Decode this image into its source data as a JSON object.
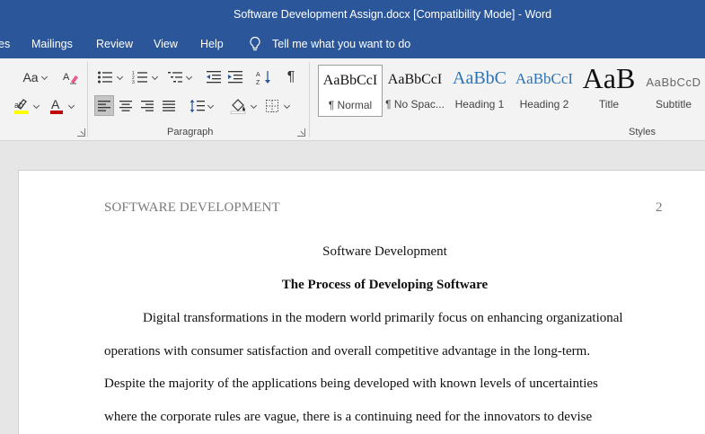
{
  "window": {
    "title": "Software Development Assign.docx [Compatibility Mode]  -  Word"
  },
  "tabs": [
    {
      "label": "es"
    },
    {
      "label": "Mailings"
    },
    {
      "label": "Review"
    },
    {
      "label": "View"
    },
    {
      "label": "Help"
    }
  ],
  "tell_me": {
    "icon": "lightbulb-icon",
    "label": "Tell me what you want to do"
  },
  "ribbon": {
    "paragraph_group_label": "Paragraph",
    "styles_group_label": "Styles",
    "font_size_label": "Aa",
    "styles": [
      {
        "sample": "AaBbCcI",
        "name": "¶ Normal",
        "selected": true
      },
      {
        "sample": "AaBbCcI",
        "name": "¶ No Spac..."
      },
      {
        "sample": "AaBbC",
        "name": "Heading 1"
      },
      {
        "sample": "AaBbCcI",
        "name": "Heading 2"
      },
      {
        "sample": "AaB",
        "name": "Title"
      },
      {
        "sample": "AaBbCcD",
        "name": "Subtitle"
      }
    ],
    "colors": {
      "highlight": "#ffff00",
      "font_color": "#c00000",
      "heading_blue": "#2e74b5",
      "accent": "#2b579a"
    }
  },
  "document": {
    "header_title": "SOFTWARE DEVELOPMENT",
    "page_number": "2",
    "title": "Software Development",
    "heading": "The Process of Developing Software",
    "lines": [
      "Digital transformations in the modern world primarily focus on enhancing organizational",
      "operations with consumer satisfaction and overall competitive advantage in the long-term.",
      "Despite the majority of the applications being developed with known levels of uncertainties",
      "where the corporate rules are vague, there is a continuing need for the innovators to devise"
    ]
  }
}
